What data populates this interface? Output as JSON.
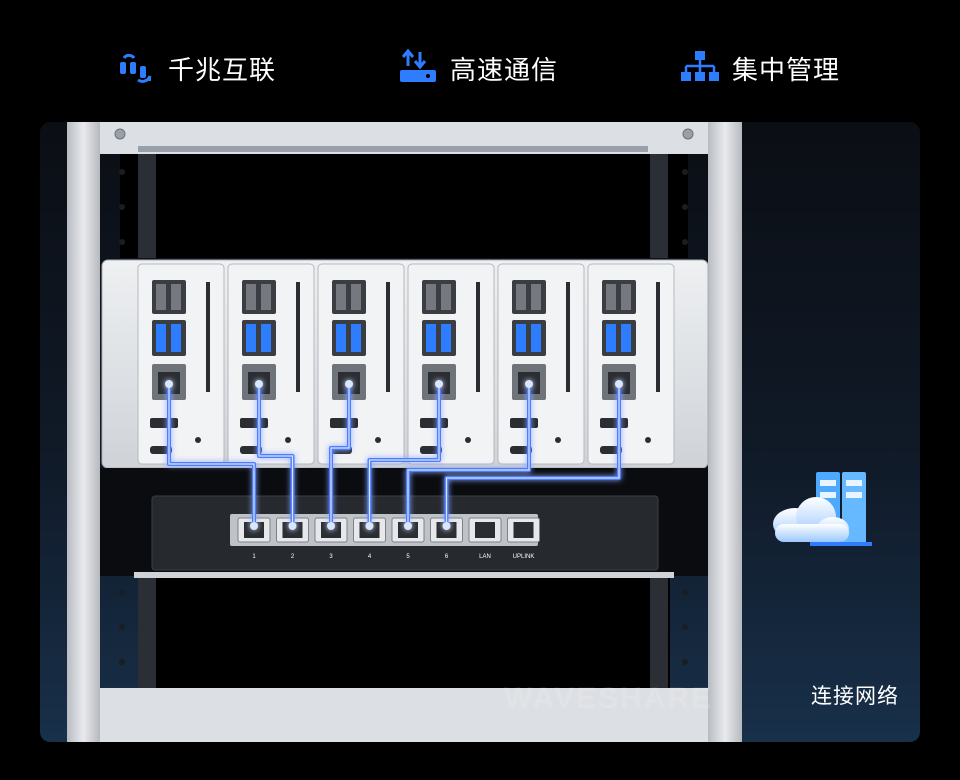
{
  "features": [
    {
      "label": "千兆互联",
      "icon": "gigabit-link-icon"
    },
    {
      "label": "高速通信",
      "icon": "upload-download-icon"
    },
    {
      "label": "集中管理",
      "icon": "network-hierarchy-icon"
    }
  ],
  "switch": {
    "port_labels": [
      "1",
      "2",
      "3",
      "4",
      "5",
      "6",
      "LAN",
      "UPLINK"
    ]
  },
  "network": {
    "label": "连接网络",
    "icon": "cloud-server-icon"
  },
  "watermark": "WAVESHARE",
  "colors": {
    "accent": "#2f7dff",
    "link": "#4d7dff",
    "background": "#000000"
  }
}
